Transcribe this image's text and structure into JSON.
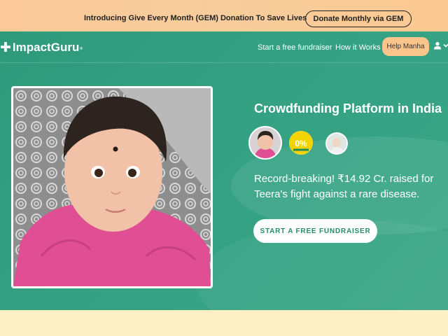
{
  "promo": {
    "text": "Introducing Give Every Month (GEM) Donation To Save Lives",
    "button_label": "Donate Monthly via GEM"
  },
  "nav": {
    "logo_text": "ImpactGuru",
    "logo_tm": "®",
    "links": [
      "Start a free fundraiser",
      "How it Works"
    ],
    "help_label": "Help Manha"
  },
  "hero": {
    "headline": "Crowdfunding Platform in India",
    "record_text": "Record-breaking! ₹14.92 Cr. raised for Teera's fight against a rare disease.",
    "cta_label": "START A FREE FUNDRAISER",
    "badge_text": "0%"
  },
  "colors": {
    "accent_green": "#34a183",
    "promo_orange": "#fbc89a",
    "help_button": "#fbc48a",
    "cta_text": "#2a8a6c"
  },
  "icons": [
    "plus-logo-icon",
    "user-icon",
    "chevron-down-icon"
  ]
}
